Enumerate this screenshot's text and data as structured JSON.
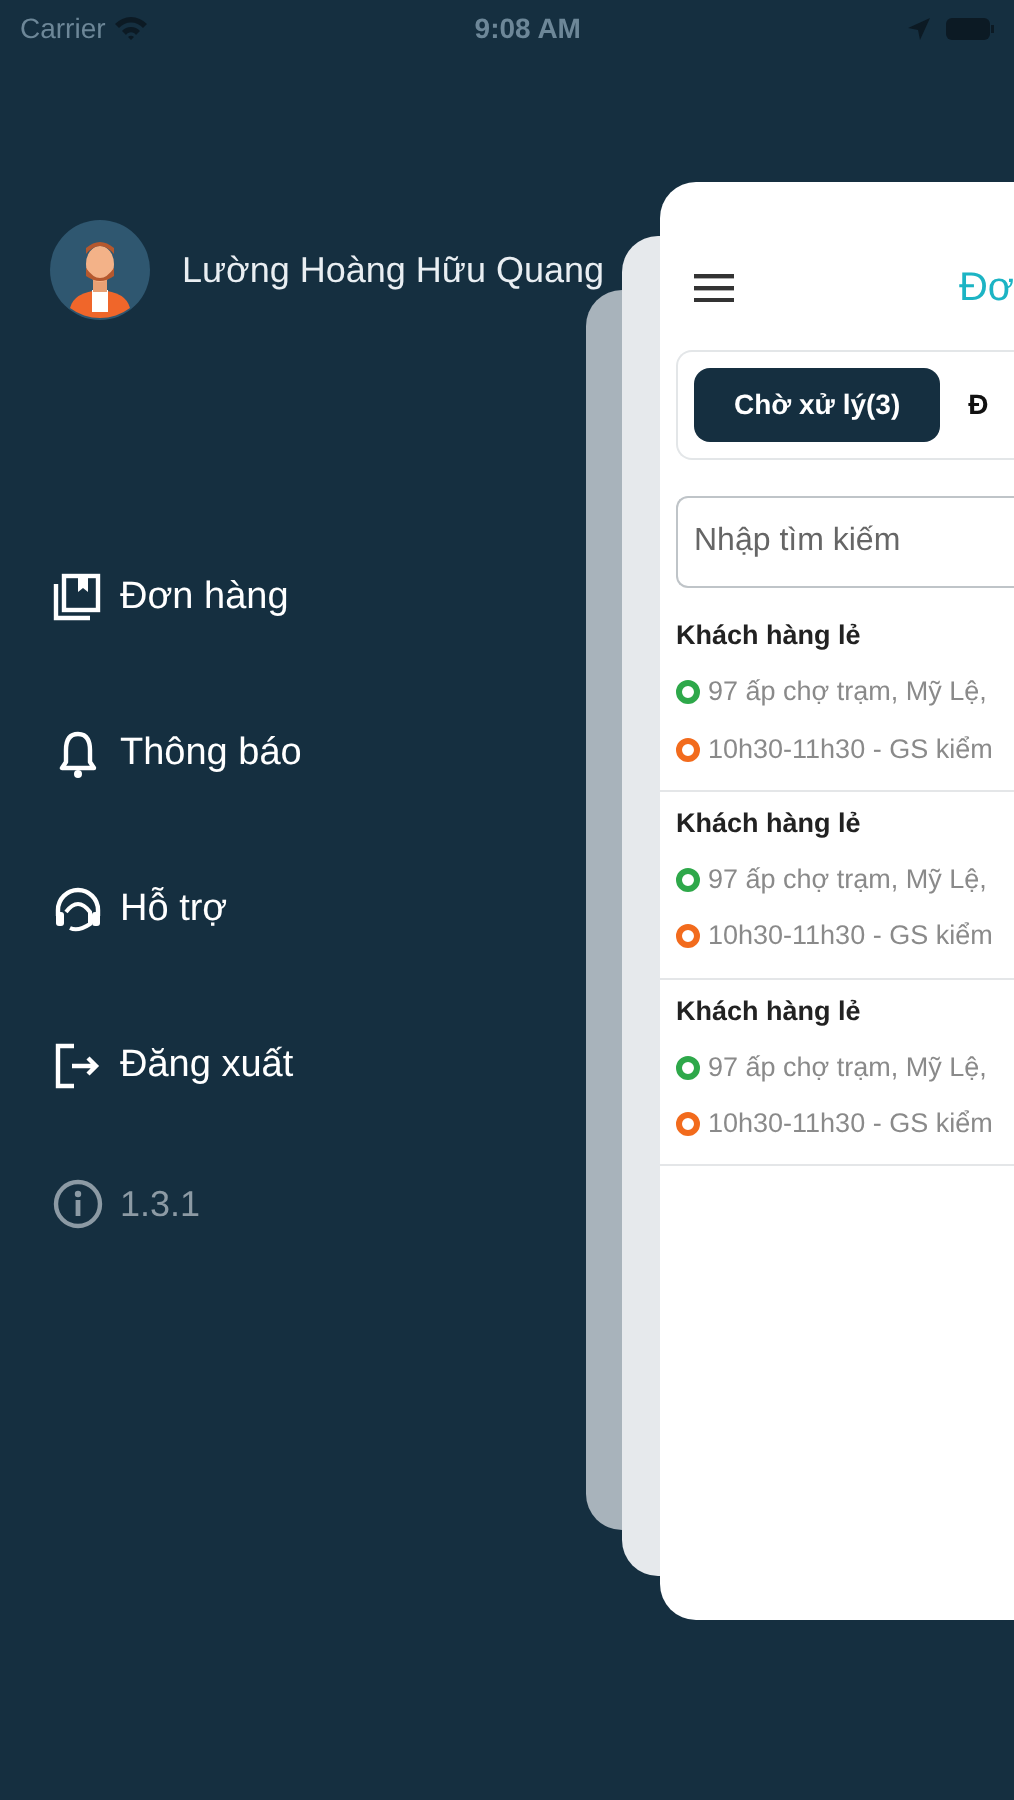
{
  "status_bar": {
    "carrier": "Carrier",
    "time": "9:08 AM"
  },
  "profile": {
    "name": "Lường Hoàng Hữu Quang"
  },
  "menu": [
    {
      "kind": "orders",
      "label": "Đơn hàng"
    },
    {
      "kind": "bell",
      "label": "Thông báo"
    },
    {
      "kind": "support",
      "label": "Hỗ trợ"
    },
    {
      "kind": "logout",
      "label": "Đăng xuất"
    }
  ],
  "version": "1.3.1",
  "panel": {
    "title": "Đơ",
    "tabs": [
      {
        "label": "Chờ xử lý(3)",
        "selected": true
      },
      {
        "label": "Đ",
        "selected": false
      }
    ],
    "search": {
      "placeholder": "Nhập tìm kiếm"
    },
    "orders": [
      {
        "customer": "Khách hàng lẻ",
        "lines": [
          {
            "text": "97 ấp chợ trạm, Mỹ Lệ,",
            "color": "#2ea84a"
          },
          {
            "text": "10h30-11h30 - GS kiểm",
            "color": "#f26b1d"
          }
        ]
      },
      {
        "customer": "Khách hàng lẻ",
        "lines": [
          {
            "text": "97 ấp chợ trạm, Mỹ Lệ,",
            "color": "#2ea84a"
          },
          {
            "text": "10h30-11h30 - GS kiểm",
            "color": "#f26b1d"
          }
        ]
      },
      {
        "customer": "Khách hàng lẻ",
        "lines": [
          {
            "text": "97 ấp chợ trạm, Mỹ Lệ,",
            "color": "#2ea84a"
          },
          {
            "text": "10h30-11h30 - GS kiểm",
            "color": "#f26b1d"
          }
        ]
      }
    ]
  }
}
